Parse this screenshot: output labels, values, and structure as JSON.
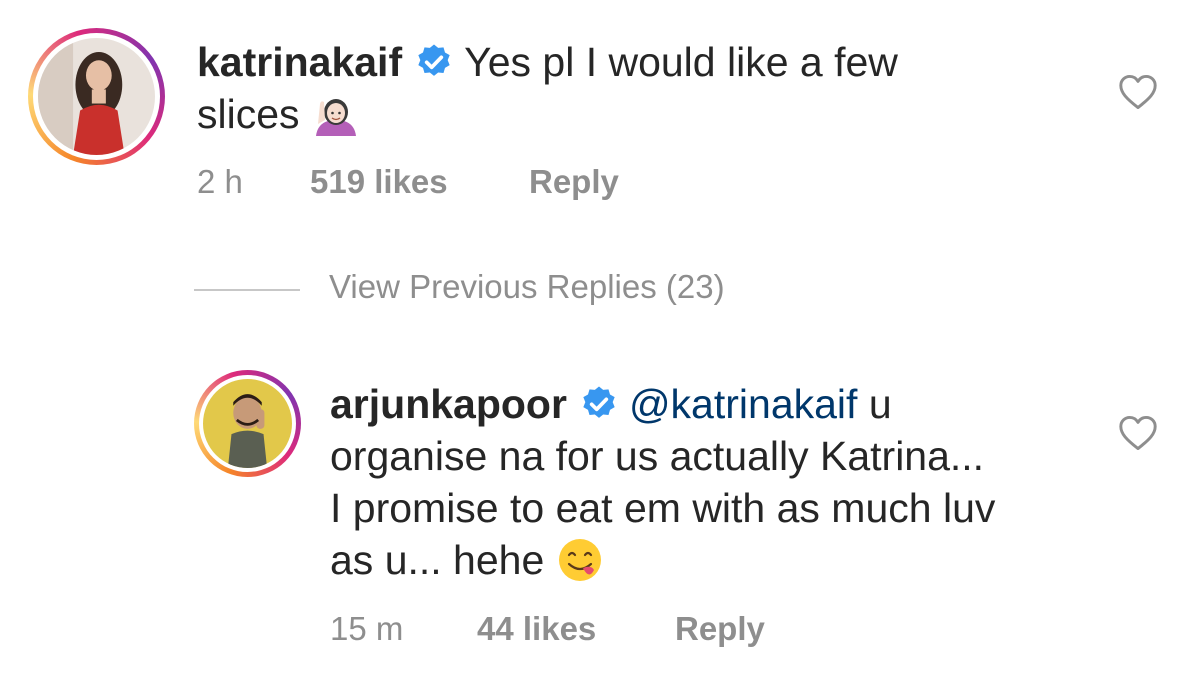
{
  "comments": [
    {
      "username": "katrinakaif",
      "verified": true,
      "text_line1": "Yes pl I would like a few",
      "text_line2": "slices",
      "emoji": "raising-hand-emoji",
      "time": "2 h",
      "likes": "519 likes",
      "reply_label": "Reply"
    },
    {
      "username": "arjunkapoor",
      "verified": true,
      "mention": "@katrinakaif",
      "text_line1_tail": "u",
      "text_line2": "organise na for us actually Katrina...",
      "text_line3": "I promise to eat em with as much luv",
      "text_line4": "as u... hehe",
      "emoji": "savoring-food-emoji",
      "time": "15 m",
      "likes": "44 likes",
      "reply_label": "Reply"
    }
  ],
  "view_previous": {
    "label": "View Previous Replies (23)"
  },
  "colors": {
    "text": "#262626",
    "muted": "#8e8e8e",
    "mention": "#00376b",
    "verified": "#3897f0"
  }
}
